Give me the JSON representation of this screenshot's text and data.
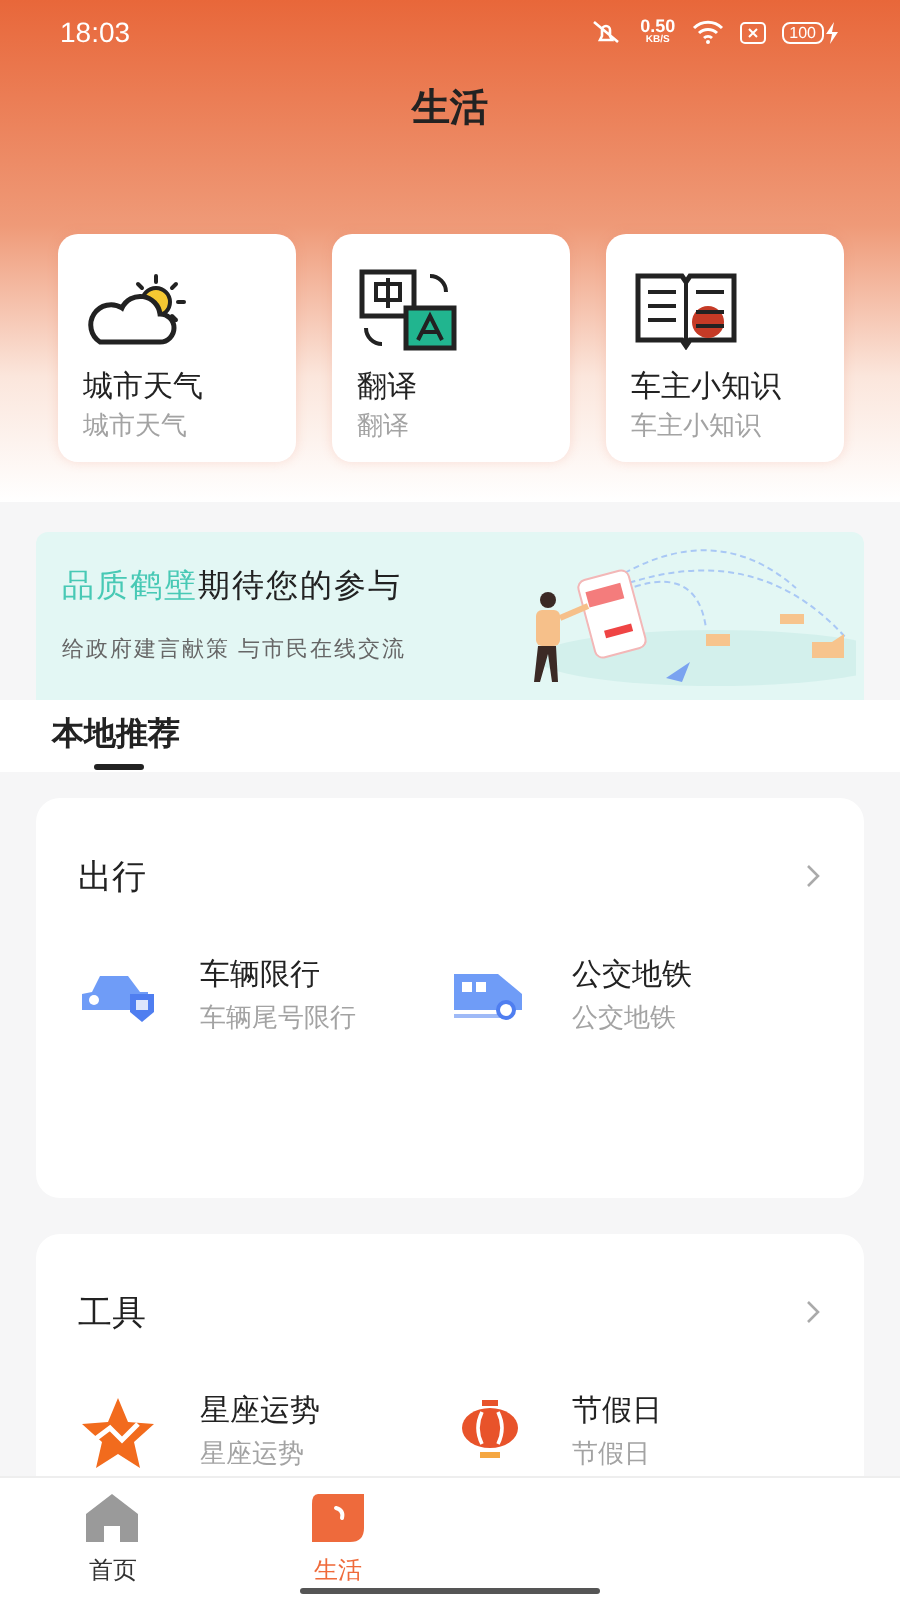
{
  "status_bar": {
    "time": "18:03",
    "net_speed": "0.50",
    "net_unit": "KB/S",
    "battery": "100"
  },
  "title": "生活",
  "quick_cards": [
    {
      "kind": "weather",
      "title": "城市天气",
      "subtitle": "城市天气"
    },
    {
      "kind": "translate",
      "title": "翻译",
      "subtitle": "翻译"
    },
    {
      "kind": "book",
      "title": "车主小知识",
      "subtitle": "车主小知识"
    }
  ],
  "banner": {
    "highlight": "品质鹤壁",
    "headline": "期待您的参与",
    "subtitle": "给政府建言献策 与市民在线交流"
  },
  "section_tabs": [
    {
      "label": "本地推荐",
      "selected": true
    }
  ],
  "groups": [
    {
      "title": "出行",
      "items": [
        {
          "kind": "car",
          "title": "车辆限行",
          "subtitle": "车辆尾号限行"
        },
        {
          "kind": "train",
          "title": "公交地铁",
          "subtitle": "公交地铁"
        }
      ]
    },
    {
      "title": "工具",
      "items": [
        {
          "kind": "star",
          "title": "星座运势",
          "subtitle": "星座运势"
        },
        {
          "kind": "lantern",
          "title": "节假日",
          "subtitle": "节假日"
        }
      ]
    }
  ],
  "bottom_nav": [
    {
      "kind": "home",
      "label": "首页",
      "selected": false
    },
    {
      "kind": "life",
      "label": "生活",
      "selected": true
    }
  ]
}
